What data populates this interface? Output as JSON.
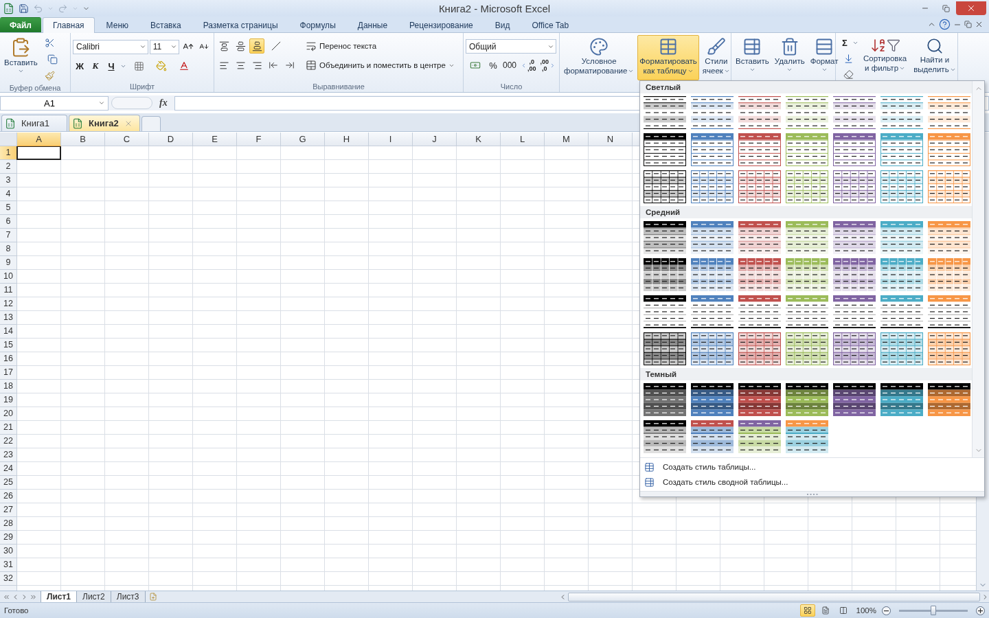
{
  "title_bar": {
    "title": "Книга2 - Microsoft Excel"
  },
  "ribbon_tabs": [
    {
      "label": "Файл",
      "kind": "file",
      "selected": false
    },
    {
      "label": "Главная",
      "kind": "tab",
      "selected": true
    },
    {
      "label": "Меню",
      "kind": "tab",
      "selected": false
    },
    {
      "label": "Вставка",
      "kind": "tab",
      "selected": false
    },
    {
      "label": "Разметка страницы",
      "kind": "tab",
      "selected": false
    },
    {
      "label": "Формулы",
      "kind": "tab",
      "selected": false
    },
    {
      "label": "Данные",
      "kind": "tab",
      "selected": false
    },
    {
      "label": "Рецензирование",
      "kind": "tab",
      "selected": false
    },
    {
      "label": "Вид",
      "kind": "tab",
      "selected": false
    },
    {
      "label": "Office Tab",
      "kind": "tab",
      "selected": false
    }
  ],
  "ribbon": {
    "clipboard": {
      "paste": "Вставить",
      "group": "Буфер обмена"
    },
    "font": {
      "font_name": "Calibri",
      "font_size": "11",
      "bold": "Ж",
      "italic": "К",
      "underline": "Ч",
      "group": "Шрифт"
    },
    "alignment": {
      "vertical": [
        {
          "selected": false
        },
        {
          "selected": false
        },
        {
          "selected": true
        }
      ],
      "wrap_text": "Перенос текста",
      "merge": "Объединить и поместить в центре",
      "group": "Выравнивание"
    },
    "number": {
      "format": "Общий",
      "percent": "%",
      "thousands": "000",
      "decimals": [
        ",0",
        ",00",
        ",00",
        ",0"
      ],
      "group": "Число"
    },
    "styles": [
      {
        "lines": [
          "Условное",
          "форматирование"
        ],
        "selected": false
      },
      {
        "lines": [
          "Форматировать",
          "как таблицу"
        ],
        "selected": true
      },
      {
        "lines": [
          "Стили",
          "ячеек"
        ],
        "selected": false
      }
    ],
    "cells": [
      {
        "label": "Вставить"
      },
      {
        "label": "Удалить"
      },
      {
        "label": "Формат"
      }
    ],
    "editing": {
      "sum": "Σ",
      "sort": [
        "Сортировка",
        "и фильтр"
      ],
      "find": [
        "Найти и",
        "выделить"
      ]
    }
  },
  "formula_bar": {
    "name_box": "A1",
    "fx": "fx"
  },
  "workbooks": [
    {
      "label": "Книга1",
      "selected": false
    },
    {
      "label": "Книга2",
      "selected": true
    }
  ],
  "grid": {
    "columns": [
      {
        "label": "A",
        "selected": true
      },
      {
        "label": "B",
        "selected": false
      },
      {
        "label": "C",
        "selected": false
      },
      {
        "label": "D",
        "selected": false
      },
      {
        "label": "E",
        "selected": false
      },
      {
        "label": "F",
        "selected": false
      },
      {
        "label": "G",
        "selected": false
      },
      {
        "label": "H",
        "selected": false
      },
      {
        "label": "I",
        "selected": false
      },
      {
        "label": "J",
        "selected": false
      },
      {
        "label": "K",
        "selected": false
      },
      {
        "label": "L",
        "selected": false
      },
      {
        "label": "M",
        "selected": false
      },
      {
        "label": "N",
        "selected": false
      }
    ],
    "rows": [
      {
        "label": "1",
        "selected": true
      },
      {
        "label": "2",
        "selected": false
      },
      {
        "label": "3",
        "selected": false
      },
      {
        "label": "4",
        "selected": false
      },
      {
        "label": "5",
        "selected": false
      },
      {
        "label": "6",
        "selected": false
      },
      {
        "label": "7",
        "selected": false
      },
      {
        "label": "8",
        "selected": false
      },
      {
        "label": "9",
        "selected": false
      },
      {
        "label": "10",
        "selected": false
      },
      {
        "label": "11",
        "selected": false
      },
      {
        "label": "12",
        "selected": false
      },
      {
        "label": "13",
        "selected": false
      },
      {
        "label": "14",
        "selected": false
      },
      {
        "label": "15",
        "selected": false
      },
      {
        "label": "16",
        "selected": false
      },
      {
        "label": "17",
        "selected": false
      },
      {
        "label": "18",
        "selected": false
      },
      {
        "label": "19",
        "selected": false
      },
      {
        "label": "20",
        "selected": false
      },
      {
        "label": "21",
        "selected": false
      },
      {
        "label": "22",
        "selected": false
      },
      {
        "label": "23",
        "selected": false
      },
      {
        "label": "24",
        "selected": false
      },
      {
        "label": "25",
        "selected": false
      },
      {
        "label": "26",
        "selected": false
      },
      {
        "label": "27",
        "selected": false
      },
      {
        "label": "28",
        "selected": false
      },
      {
        "label": "29",
        "selected": false
      },
      {
        "label": "30",
        "selected": false
      },
      {
        "label": "31",
        "selected": false
      },
      {
        "label": "32",
        "selected": false
      }
    ]
  },
  "sheets": [
    {
      "label": "Лист1",
      "selected": true
    },
    {
      "label": "Лист2",
      "selected": false
    },
    {
      "label": "Лист3",
      "selected": false
    }
  ],
  "status_bar": {
    "status": "Готово",
    "zoom": "100%",
    "zoom_slider": {
      "level": 0.5
    }
  },
  "table_styles_menu": {
    "sections": [
      {
        "title": "Светлый",
        "styles": [
          {
            "kind": "light-banded",
            "color": "#000000"
          },
          {
            "kind": "light-banded",
            "color": "#4f81bd"
          },
          {
            "kind": "light-banded",
            "color": "#c0504d"
          },
          {
            "kind": "light-banded",
            "color": "#9bbb59"
          },
          {
            "kind": "light-banded",
            "color": "#8064a2"
          },
          {
            "kind": "light-banded",
            "color": "#4bacc6"
          },
          {
            "kind": "light-banded",
            "color": "#f79646"
          },
          {
            "kind": "light-header",
            "color": "#000000"
          },
          {
            "kind": "light-header",
            "color": "#4f81bd"
          },
          {
            "kind": "light-header",
            "color": "#c0504d"
          },
          {
            "kind": "light-header",
            "color": "#9bbb59"
          },
          {
            "kind": "light-header",
            "color": "#8064a2"
          },
          {
            "kind": "light-header",
            "color": "#4bacc6"
          },
          {
            "kind": "light-header",
            "color": "#f79646"
          },
          {
            "kind": "light-grid",
            "color": "#000000"
          },
          {
            "kind": "light-grid",
            "color": "#4f81bd"
          },
          {
            "kind": "light-grid",
            "color": "#c0504d"
          },
          {
            "kind": "light-grid",
            "color": "#9bbb59"
          },
          {
            "kind": "light-grid",
            "color": "#8064a2"
          },
          {
            "kind": "light-grid",
            "color": "#4bacc6"
          },
          {
            "kind": "light-grid",
            "color": "#f79646"
          }
        ]
      },
      {
        "title": "Средний",
        "styles": [
          {
            "kind": "medium-header",
            "color": "#000000"
          },
          {
            "kind": "medium-header",
            "color": "#4f81bd"
          },
          {
            "kind": "medium-header",
            "color": "#c0504d"
          },
          {
            "kind": "medium-header",
            "color": "#9bbb59"
          },
          {
            "kind": "medium-header",
            "color": "#8064a2"
          },
          {
            "kind": "medium-header",
            "color": "#4bacc6"
          },
          {
            "kind": "medium-header",
            "color": "#f79646"
          },
          {
            "kind": "medium-grid",
            "color": "#000000"
          },
          {
            "kind": "medium-grid",
            "color": "#4f81bd"
          },
          {
            "kind": "medium-grid",
            "color": "#c0504d"
          },
          {
            "kind": "medium-grid",
            "color": "#9bbb59"
          },
          {
            "kind": "medium-grid",
            "color": "#8064a2"
          },
          {
            "kind": "medium-grid",
            "color": "#4bacc6"
          },
          {
            "kind": "medium-grid",
            "color": "#f79646"
          },
          {
            "kind": "medium-lines",
            "color": "#000000"
          },
          {
            "kind": "medium-lines",
            "color": "#4f81bd"
          },
          {
            "kind": "medium-lines",
            "color": "#c0504d"
          },
          {
            "kind": "medium-lines",
            "color": "#9bbb59"
          },
          {
            "kind": "medium-lines",
            "color": "#8064a2"
          },
          {
            "kind": "medium-lines",
            "color": "#4bacc6"
          },
          {
            "kind": "medium-lines",
            "color": "#f79646"
          },
          {
            "kind": "medium-tint-grid",
            "color": "#000000"
          },
          {
            "kind": "medium-tint-grid",
            "color": "#4f81bd"
          },
          {
            "kind": "medium-tint-grid",
            "color": "#c0504d"
          },
          {
            "kind": "medium-tint-grid",
            "color": "#9bbb59"
          },
          {
            "kind": "medium-tint-grid",
            "color": "#8064a2"
          },
          {
            "kind": "medium-tint-grid",
            "color": "#4bacc6"
          },
          {
            "kind": "medium-tint-grid",
            "color": "#f79646"
          }
        ]
      },
      {
        "title": "Темный",
        "styles": [
          {
            "kind": "dark",
            "color": "#737373"
          },
          {
            "kind": "dark",
            "color": "#4f81bd"
          },
          {
            "kind": "dark",
            "color": "#c0504d"
          },
          {
            "kind": "dark",
            "color": "#9bbb59"
          },
          {
            "kind": "dark",
            "color": "#8064a2"
          },
          {
            "kind": "dark",
            "color": "#4bacc6"
          },
          {
            "kind": "dark",
            "color": "#f79646"
          },
          {
            "kind": "dark-contrast",
            "color": "#000000",
            "band": {
              "color": "#7f7f7f"
            }
          },
          {
            "kind": "dark-contrast",
            "color": "#c0504d",
            "band": {
              "color": "#4f81bd"
            }
          },
          {
            "kind": "dark-contrast",
            "color": "#8064a2",
            "band": {
              "color": "#9bbb59"
            }
          },
          {
            "kind": "dark-contrast",
            "color": "#f79646",
            "band": {
              "color": "#4bacc6"
            }
          }
        ]
      }
    ],
    "actions": [
      "Создать стиль таблицы...",
      "Создать стиль сводной таблицы..."
    ]
  }
}
